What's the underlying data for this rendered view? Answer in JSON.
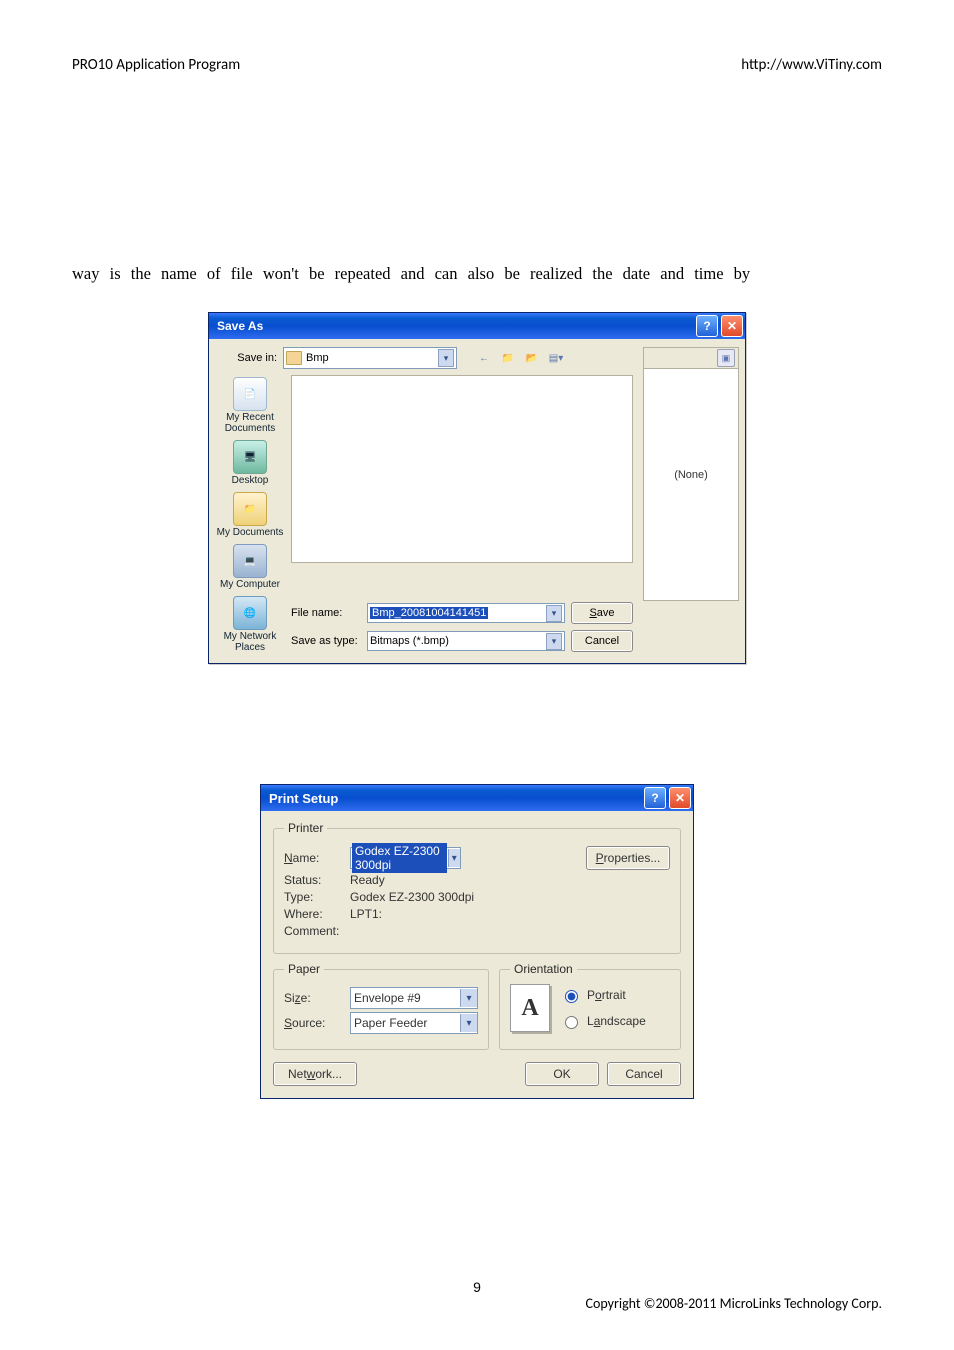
{
  "header": {
    "left": "PRO10 Application Program",
    "right": "http://www.ViTiny.com"
  },
  "bodyText": "way is the name of file won't be repeated   and can also be realized the date and time by",
  "saveAs": {
    "title": "Save As",
    "saveInLabel": "Save in:",
    "saveInFolder": "Bmp",
    "places": {
      "recent": "My Recent\nDocuments",
      "desktop": "Desktop",
      "documents": "My Documents",
      "computer": "My Computer",
      "network": "My Network\nPlaces"
    },
    "fileNameLabel": "File name:",
    "fileNameValue": "Bmp_20081004141451",
    "saveTypeLabel": "Save as type:",
    "saveTypeValue": "Bitmaps (*.bmp)",
    "saveBtn": "Save",
    "cancelBtn": "Cancel",
    "previewNone": "(None)"
  },
  "printSetup": {
    "title": "Print Setup",
    "printerLegend": "Printer",
    "nameLabel": "Name:",
    "nameValue": "Godex EZ-2300 300dpi",
    "propertiesBtn": "Properties...",
    "statusLabel": "Status:",
    "statusValue": "Ready",
    "typeLabel": "Type:",
    "typeValue": "Godex EZ-2300 300dpi",
    "whereLabel": "Where:",
    "whereValue": "LPT1:",
    "commentLabel": "Comment:",
    "commentValue": "",
    "paperLegend": "Paper",
    "sizeLabel": "Size:",
    "sizeValue": "Envelope #9",
    "sourceLabel": "Source:",
    "sourceValue": "Paper Feeder",
    "orientationLegend": "Orientation",
    "orientationPreview": "A",
    "portraitLabel": "Portrait",
    "landscapeLabel": "Landscape",
    "networkBtn": "Network...",
    "okBtn": "OK",
    "cancelBtn": "Cancel"
  },
  "footer": {
    "pageNumber": "9",
    "copyright": "Copyright ©2008-2011 MicroLinks Technology Corp."
  }
}
